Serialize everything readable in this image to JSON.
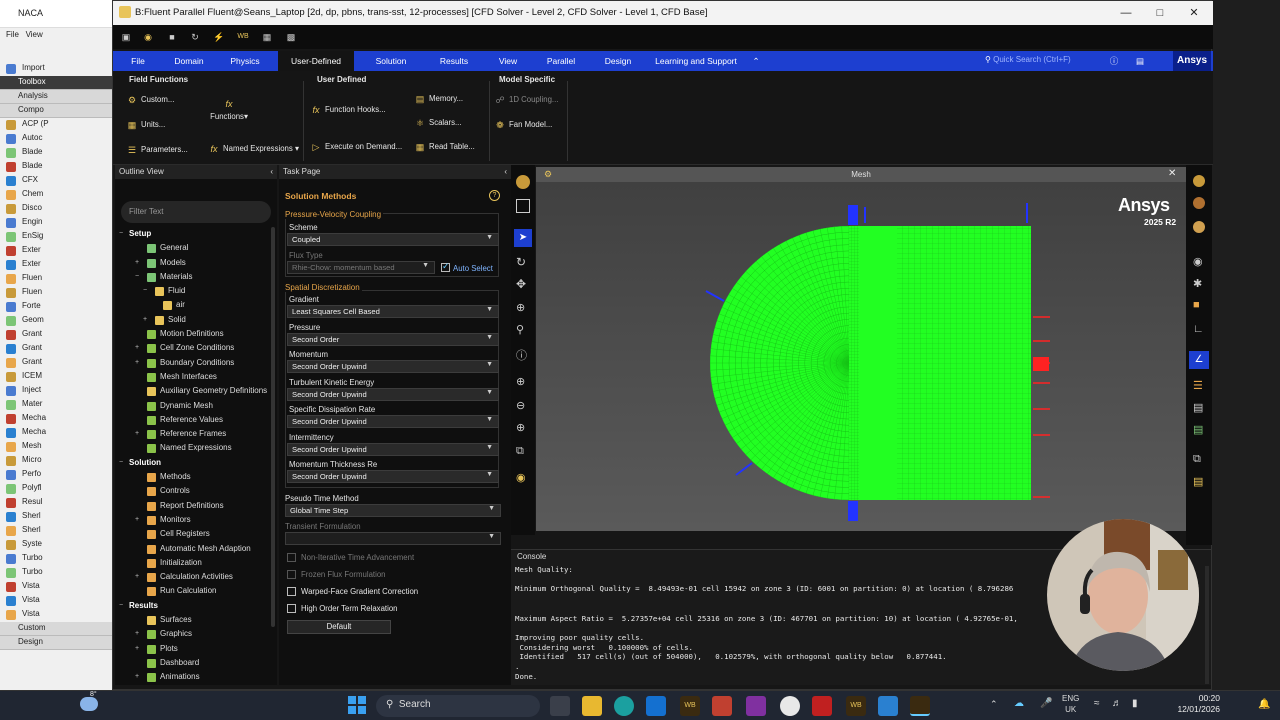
{
  "bg_window": {
    "title": "NACA",
    "menu": [
      "File",
      "View"
    ],
    "toolbox_label": "Toolbox",
    "import_label": "Import",
    "analysis_label": "Analysis",
    "component_label": "Compo",
    "items": [
      "ACP (P",
      "Autoc",
      "Blade",
      "Blade",
      "CFX",
      "Chem",
      "Disco",
      "Engin",
      "EnSig",
      "Exter",
      "Exter",
      "Fluen",
      "Fluen",
      "Forte",
      "Geom",
      "Grant",
      "Grant",
      "Grant",
      "ICEM",
      "Inject",
      "Mater",
      "Mecha",
      "Mecha",
      "Mesh",
      "Micro",
      "Perfo",
      "Polyfl",
      "Resul",
      "Sherl",
      "Sherl",
      "Syste",
      "Turbo",
      "Turbo",
      "Vista",
      "Vista",
      "Vista"
    ],
    "custom_label": "Custom",
    "design_label": "Design"
  },
  "titlebar": {
    "title": "B:Fluent Parallel Fluent@Seans_Laptop  [2d, dp, pbns, trans-sst, 12-processes] [CFD Solver - Level 2, CFD Solver - Level 1, CFD Base]"
  },
  "ribbon": {
    "tabs": [
      "File",
      "Domain",
      "Physics",
      "User-Defined",
      "Solution",
      "Results",
      "View",
      "Parallel",
      "Design",
      "Learning and Support"
    ],
    "search_placeholder": "Quick Search (Ctrl+F)",
    "brand": "Ansys",
    "groups": {
      "field_functions": {
        "title": "Field Functions",
        "items": [
          "Custom...",
          "Units...",
          "Parameters..."
        ]
      },
      "functions_label": "Functions",
      "named_expressions": "Named Expressions",
      "user_defined": {
        "title": "User Defined",
        "items": [
          "Function Hooks...",
          "Execute on Demand...",
          "Memory...",
          "Scalars...",
          "Read Table..."
        ]
      },
      "model_specific": {
        "title": "Model Specific",
        "items": [
          "1D Coupling...",
          "Fan Model..."
        ]
      }
    }
  },
  "outline": {
    "title": "Outline View",
    "filter_placeholder": "Filter Text",
    "tree": [
      {
        "label": "Setup",
        "level": 0,
        "section": true,
        "exp": "−"
      },
      {
        "label": "General",
        "level": 2,
        "icon": "#7cc576"
      },
      {
        "label": "Models",
        "level": 2,
        "icon": "#7cc576",
        "exp": "+"
      },
      {
        "label": "Materials",
        "level": 2,
        "icon": "#7cc576",
        "exp": "−"
      },
      {
        "label": "Fluid",
        "level": 3,
        "icon": "#e8c45a",
        "exp": "−"
      },
      {
        "label": "air",
        "level": 4,
        "icon": "#e8c45a"
      },
      {
        "label": "Solid",
        "level": 3,
        "icon": "#e8c45a",
        "exp": "+"
      },
      {
        "label": "Motion Definitions",
        "level": 2,
        "icon": "#8bc34a"
      },
      {
        "label": "Cell Zone Conditions",
        "level": 2,
        "icon": "#8bc34a",
        "exp": "+"
      },
      {
        "label": "Boundary Conditions",
        "level": 2,
        "icon": "#8bc34a",
        "exp": "+"
      },
      {
        "label": "Mesh Interfaces",
        "level": 2,
        "icon": "#8bc34a"
      },
      {
        "label": "Auxiliary Geometry Definitions",
        "level": 2,
        "icon": "#e8c45a"
      },
      {
        "label": "Dynamic Mesh",
        "level": 2,
        "icon": "#8bc34a"
      },
      {
        "label": "Reference Values",
        "level": 2,
        "icon": "#8bc34a"
      },
      {
        "label": "Reference Frames",
        "level": 2,
        "icon": "#8bc34a",
        "exp": "+"
      },
      {
        "label": "Named Expressions",
        "level": 2,
        "icon": "#8bc34a"
      },
      {
        "label": "Solution",
        "level": 0,
        "section": true,
        "exp": "−"
      },
      {
        "label": "Methods",
        "level": 2,
        "icon": "#e8a64a"
      },
      {
        "label": "Controls",
        "level": 2,
        "icon": "#e8a64a"
      },
      {
        "label": "Report Definitions",
        "level": 2,
        "icon": "#e8a64a"
      },
      {
        "label": "Monitors",
        "level": 2,
        "icon": "#e8a64a",
        "exp": "+"
      },
      {
        "label": "Cell Registers",
        "level": 2,
        "icon": "#e8a64a"
      },
      {
        "label": "Automatic Mesh Adaption",
        "level": 2,
        "icon": "#e8a64a"
      },
      {
        "label": "Initialization",
        "level": 2,
        "icon": "#e8a64a"
      },
      {
        "label": "Calculation Activities",
        "level": 2,
        "icon": "#e8a64a",
        "exp": "+"
      },
      {
        "label": "Run Calculation",
        "level": 2,
        "icon": "#e8a64a"
      },
      {
        "label": "Results",
        "level": 0,
        "section": true,
        "exp": "−"
      },
      {
        "label": "Surfaces",
        "level": 2,
        "icon": "#e8c45a"
      },
      {
        "label": "Graphics",
        "level": 2,
        "icon": "#8bc34a",
        "exp": "+"
      },
      {
        "label": "Plots",
        "level": 2,
        "icon": "#8bc34a",
        "exp": "+"
      },
      {
        "label": "Dashboard",
        "level": 2,
        "icon": "#8bc34a"
      },
      {
        "label": "Animations",
        "level": 2,
        "icon": "#8bc34a",
        "exp": "+"
      }
    ]
  },
  "task": {
    "title": "Task Page",
    "heading": "Solution Methods",
    "pv_coupling": "Pressure-Velocity Coupling",
    "scheme_label": "Scheme",
    "scheme_value": "Coupled",
    "flux_type_label": "Flux Type",
    "flux_type_value": "Rhie-Chow: momentum based",
    "auto_select": "Auto Select",
    "spatial": "Spatial Discretization",
    "fields": [
      {
        "label": "Gradient",
        "value": "Least Squares Cell Based"
      },
      {
        "label": "Pressure",
        "value": "Second Order"
      },
      {
        "label": "Momentum",
        "value": "Second Order Upwind"
      },
      {
        "label": "Turbulent Kinetic Energy",
        "value": "Second Order Upwind"
      },
      {
        "label": "Specific Dissipation Rate",
        "value": "Second Order Upwind"
      },
      {
        "label": "Intermittency",
        "value": "Second Order Upwind"
      },
      {
        "label": "Momentum Thickness Re",
        "value": "Second Order Upwind"
      }
    ],
    "pseudo_label": "Pseudo Time Method",
    "pseudo_value": "Global Time Step",
    "transient_label": "Transient Formulation",
    "checks": [
      {
        "label": "Non-Iterative Time Advancement",
        "disabled": true
      },
      {
        "label": "Frozen Flux Formulation",
        "disabled": true
      },
      {
        "label": "Warped-Face Gradient Correction",
        "disabled": false
      },
      {
        "label": "High Order Term Relaxation",
        "disabled": false
      }
    ],
    "default_button": "Default"
  },
  "graphics": {
    "title": "Mesh",
    "brand": "Ansys",
    "version": "2025 R2",
    "mesh_color": "#22ff22"
  },
  "console": {
    "title": "Console",
    "lines": [
      "Mesh Quality:",
      "",
      "Minimum Orthogonal Quality =  8.49493e-01 cell 15942 on zone 3 (ID: 6001 on partition: 0) at location ( 8.796286",
      "",
      "",
      "Maximum Aspect Ratio =  5.27357e+04 cell 25316 on zone 3 (ID: 467701 on partition: 10) at location ( 4.92765e-01,",
      "",
      "Improving poor quality cells.",
      " Considering worst   0.100000% of cells.",
      " Identified   517 cell(s) (out of 504000),   0.102579%, with orthogonal quality below   0.877441.",
      ".",
      "Done."
    ]
  },
  "taskbar": {
    "weather": "8°",
    "search": "Search",
    "lang1": "ENG",
    "lang2": "UK",
    "time": "00:20",
    "date": "12/01/2026"
  }
}
